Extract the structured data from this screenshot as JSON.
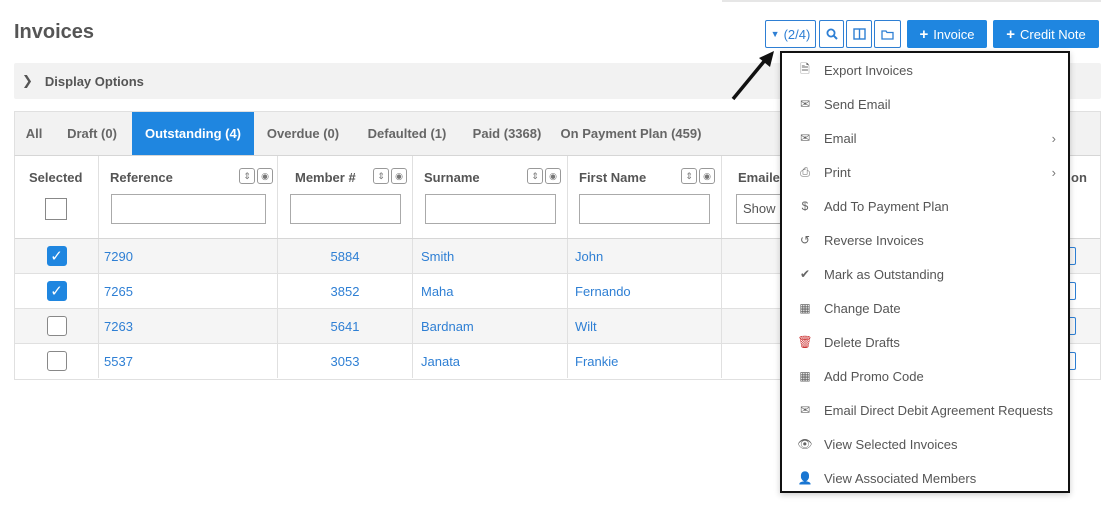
{
  "page": {
    "title": "Invoices"
  },
  "toolbar": {
    "count_label": "(2/4)",
    "invoice_label": "Invoice",
    "credit_note_label": "Credit Note",
    "search_icon": "search-icon",
    "columns_icon": "columns-icon",
    "folder_icon": "folder-icon"
  },
  "display_options": {
    "label": "Display Options"
  },
  "tabs": [
    {
      "label": "All",
      "active": false
    },
    {
      "label": "Draft (0)",
      "active": false
    },
    {
      "label": "Outstanding (4)",
      "active": true
    },
    {
      "label": "Overdue (0)",
      "active": false
    },
    {
      "label": "Defaulted (1)",
      "active": false
    },
    {
      "label": "Paid (3368)",
      "active": false
    },
    {
      "label": "On Payment Plan (459)",
      "active": false
    }
  ],
  "table": {
    "headers": {
      "selected": "Selected",
      "reference": "Reference",
      "member": "Member #",
      "surname": "Surname",
      "first_name": "First Name",
      "emailed": "Emaile",
      "last": "on"
    },
    "emailed_filter_value": "Show",
    "rows": [
      {
        "selected": true,
        "reference": "7290",
        "member": "5884",
        "surname": "Smith",
        "first_name": "John"
      },
      {
        "selected": true,
        "reference": "7265",
        "member": "3852",
        "surname": "Maha",
        "first_name": "Fernando"
      },
      {
        "selected": false,
        "reference": "7263",
        "member": "5641",
        "surname": "Bardnam",
        "first_name": "Wilt"
      },
      {
        "selected": false,
        "reference": "5537",
        "member": "3053",
        "surname": "Janata",
        "first_name": "Frankie"
      }
    ]
  },
  "menu": {
    "items": [
      {
        "label": "Export Invoices",
        "icon": "excel-file-icon",
        "glyph": "🗎",
        "submenu": false
      },
      {
        "label": "Send Email",
        "icon": "envelope-icon",
        "glyph": "✉",
        "submenu": false
      },
      {
        "label": "Email",
        "icon": "envelope-icon",
        "glyph": "✉",
        "submenu": true
      },
      {
        "label": "Print",
        "icon": "print-icon",
        "glyph": "⎙",
        "submenu": true
      },
      {
        "label": "Add To Payment Plan",
        "icon": "dollar-icon",
        "glyph": "$",
        "submenu": false
      },
      {
        "label": "Reverse Invoices",
        "icon": "undo-icon",
        "glyph": "↺",
        "submenu": false
      },
      {
        "label": "Mark as Outstanding",
        "icon": "check-icon",
        "glyph": "✔",
        "submenu": false
      },
      {
        "label": "Change Date",
        "icon": "calendar-icon",
        "glyph": "▦",
        "submenu": false
      },
      {
        "label": "Delete Drafts",
        "icon": "trash-icon",
        "glyph": "🗑",
        "submenu": false
      },
      {
        "label": "Add Promo Code",
        "icon": "calendar-icon",
        "glyph": "▦",
        "submenu": false
      },
      {
        "label": "Email Direct Debit Agreement Requests",
        "icon": "envelope-icon",
        "glyph": "✉",
        "submenu": false
      },
      {
        "label": "View Selected Invoices",
        "icon": "eye-icon",
        "glyph": "👁",
        "submenu": false
      },
      {
        "label": "View Associated Members",
        "icon": "user-icon",
        "glyph": "👤",
        "submenu": false
      }
    ]
  },
  "colors": {
    "accent": "#1f86e0",
    "link": "#2e7fd4",
    "menu_border": "#111111"
  }
}
